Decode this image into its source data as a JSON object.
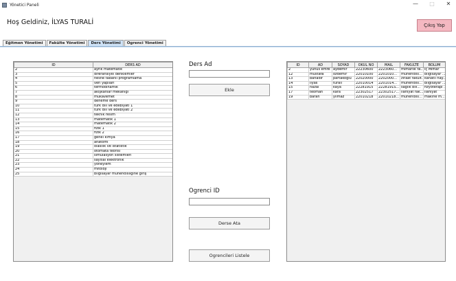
{
  "window": {
    "title": "Yönetici Paneli",
    "minimize": "—",
    "maximize": "□",
    "close": "✕"
  },
  "header": {
    "welcome": "Hoş Geldiniz, İLYAS TURALİ",
    "logout_label": "Çıkış Yap"
  },
  "tabs": [
    {
      "label": "Eğitmen Yönetimi",
      "active": false
    },
    {
      "label": "Fakülte Yönetimi",
      "active": false
    },
    {
      "label": "Ders Yönetimi",
      "active": true
    },
    {
      "label": "Ogrenci Yönetimi",
      "active": false
    }
  ],
  "course_table": {
    "columns": [
      "ID",
      "DERS AD"
    ],
    "rows": [
      [
        "2",
        "ayrık matematik"
      ],
      [
        "3",
        "diferansiyel denklemler"
      ],
      [
        "4",
        "nesne tabanlı programlama"
      ],
      [
        "5",
        "veri yapıları"
      ],
      [
        "6",
        "termodinamik"
      ],
      [
        "7",
        "akışkanlar mekaniği"
      ],
      [
        "8",
        "mukavemet"
      ],
      [
        "9",
        "deneme ders"
      ],
      [
        "10",
        "türk dili ve edebiyatı 1"
      ],
      [
        "11",
        "türk dili ve edebiyatı 2"
      ],
      [
        "12",
        "teknik resim"
      ],
      [
        "13",
        "matematik 1"
      ],
      [
        "14",
        "matematik 2"
      ],
      [
        "15",
        "fizik 1"
      ],
      [
        "16",
        "fizik 2"
      ],
      [
        "17",
        "genel kimya"
      ],
      [
        "18",
        "anatomi"
      ],
      [
        "19",
        "olasılık ve istatistik"
      ],
      [
        "20",
        "otomata teorisi"
      ],
      [
        "21",
        "simülasyon sistemleri"
      ],
      [
        "22",
        "sayısal elektronik"
      ],
      [
        "23",
        "yöneylem"
      ],
      [
        "24",
        "mitoloji"
      ],
      [
        "25",
        "bilgisayar mühendisliğine giriş"
      ]
    ]
  },
  "form": {
    "course_name_label": "Ders Ad",
    "course_name_value": "",
    "add_label": "Ekle",
    "student_id_label": "Ogrenci ID",
    "student_id_value": "",
    "assign_label": "Derse Ata",
    "list_students_label": "Ogrencileri Listele"
  },
  "student_table": {
    "columns": [
      "ID",
      "AD",
      "SOYAD",
      "OKUL NO",
      "MAIL",
      "FAKULTE",
      "BOLUM"
    ],
    "rows": [
      [
        "2",
        "yunus emre",
        "aydemir",
        "22230600",
        "2223060...",
        "mimarlık fa...",
        "iç Mimar"
      ],
      [
        "12",
        "mustafa",
        "özdemir",
        "22010100",
        "2201010...",
        "mühendisl...",
        "bilgisayar ..."
      ],
      [
        "13",
        "bahadır",
        "partakoğlu",
        "22020000",
        "2202000...",
        "ziraat fakült...",
        "kanatlı hay..."
      ],
      [
        "14",
        "ilyas",
        "turalı",
        "22010014",
        "2201014...",
        "mühendisl...",
        "bilgisayar ..."
      ],
      [
        "15",
        "hazal",
        "kaya",
        "22281915",
        "2228191S...",
        "sağlık bili...",
        "fizyoterapi ..."
      ],
      [
        "17",
        "teoman",
        "kara",
        "22302517",
        "2230251​7...",
        "ilahiyat fak...",
        "ilahiyat"
      ],
      [
        "19",
        "baran",
        "yılmaz",
        "22010218",
        "2201021​8...",
        "mühendisl...",
        "makine m..."
      ]
    ]
  },
  "colors": {
    "logout_bg": "#f4b8c1",
    "active_tab": "#cfe3f7"
  }
}
